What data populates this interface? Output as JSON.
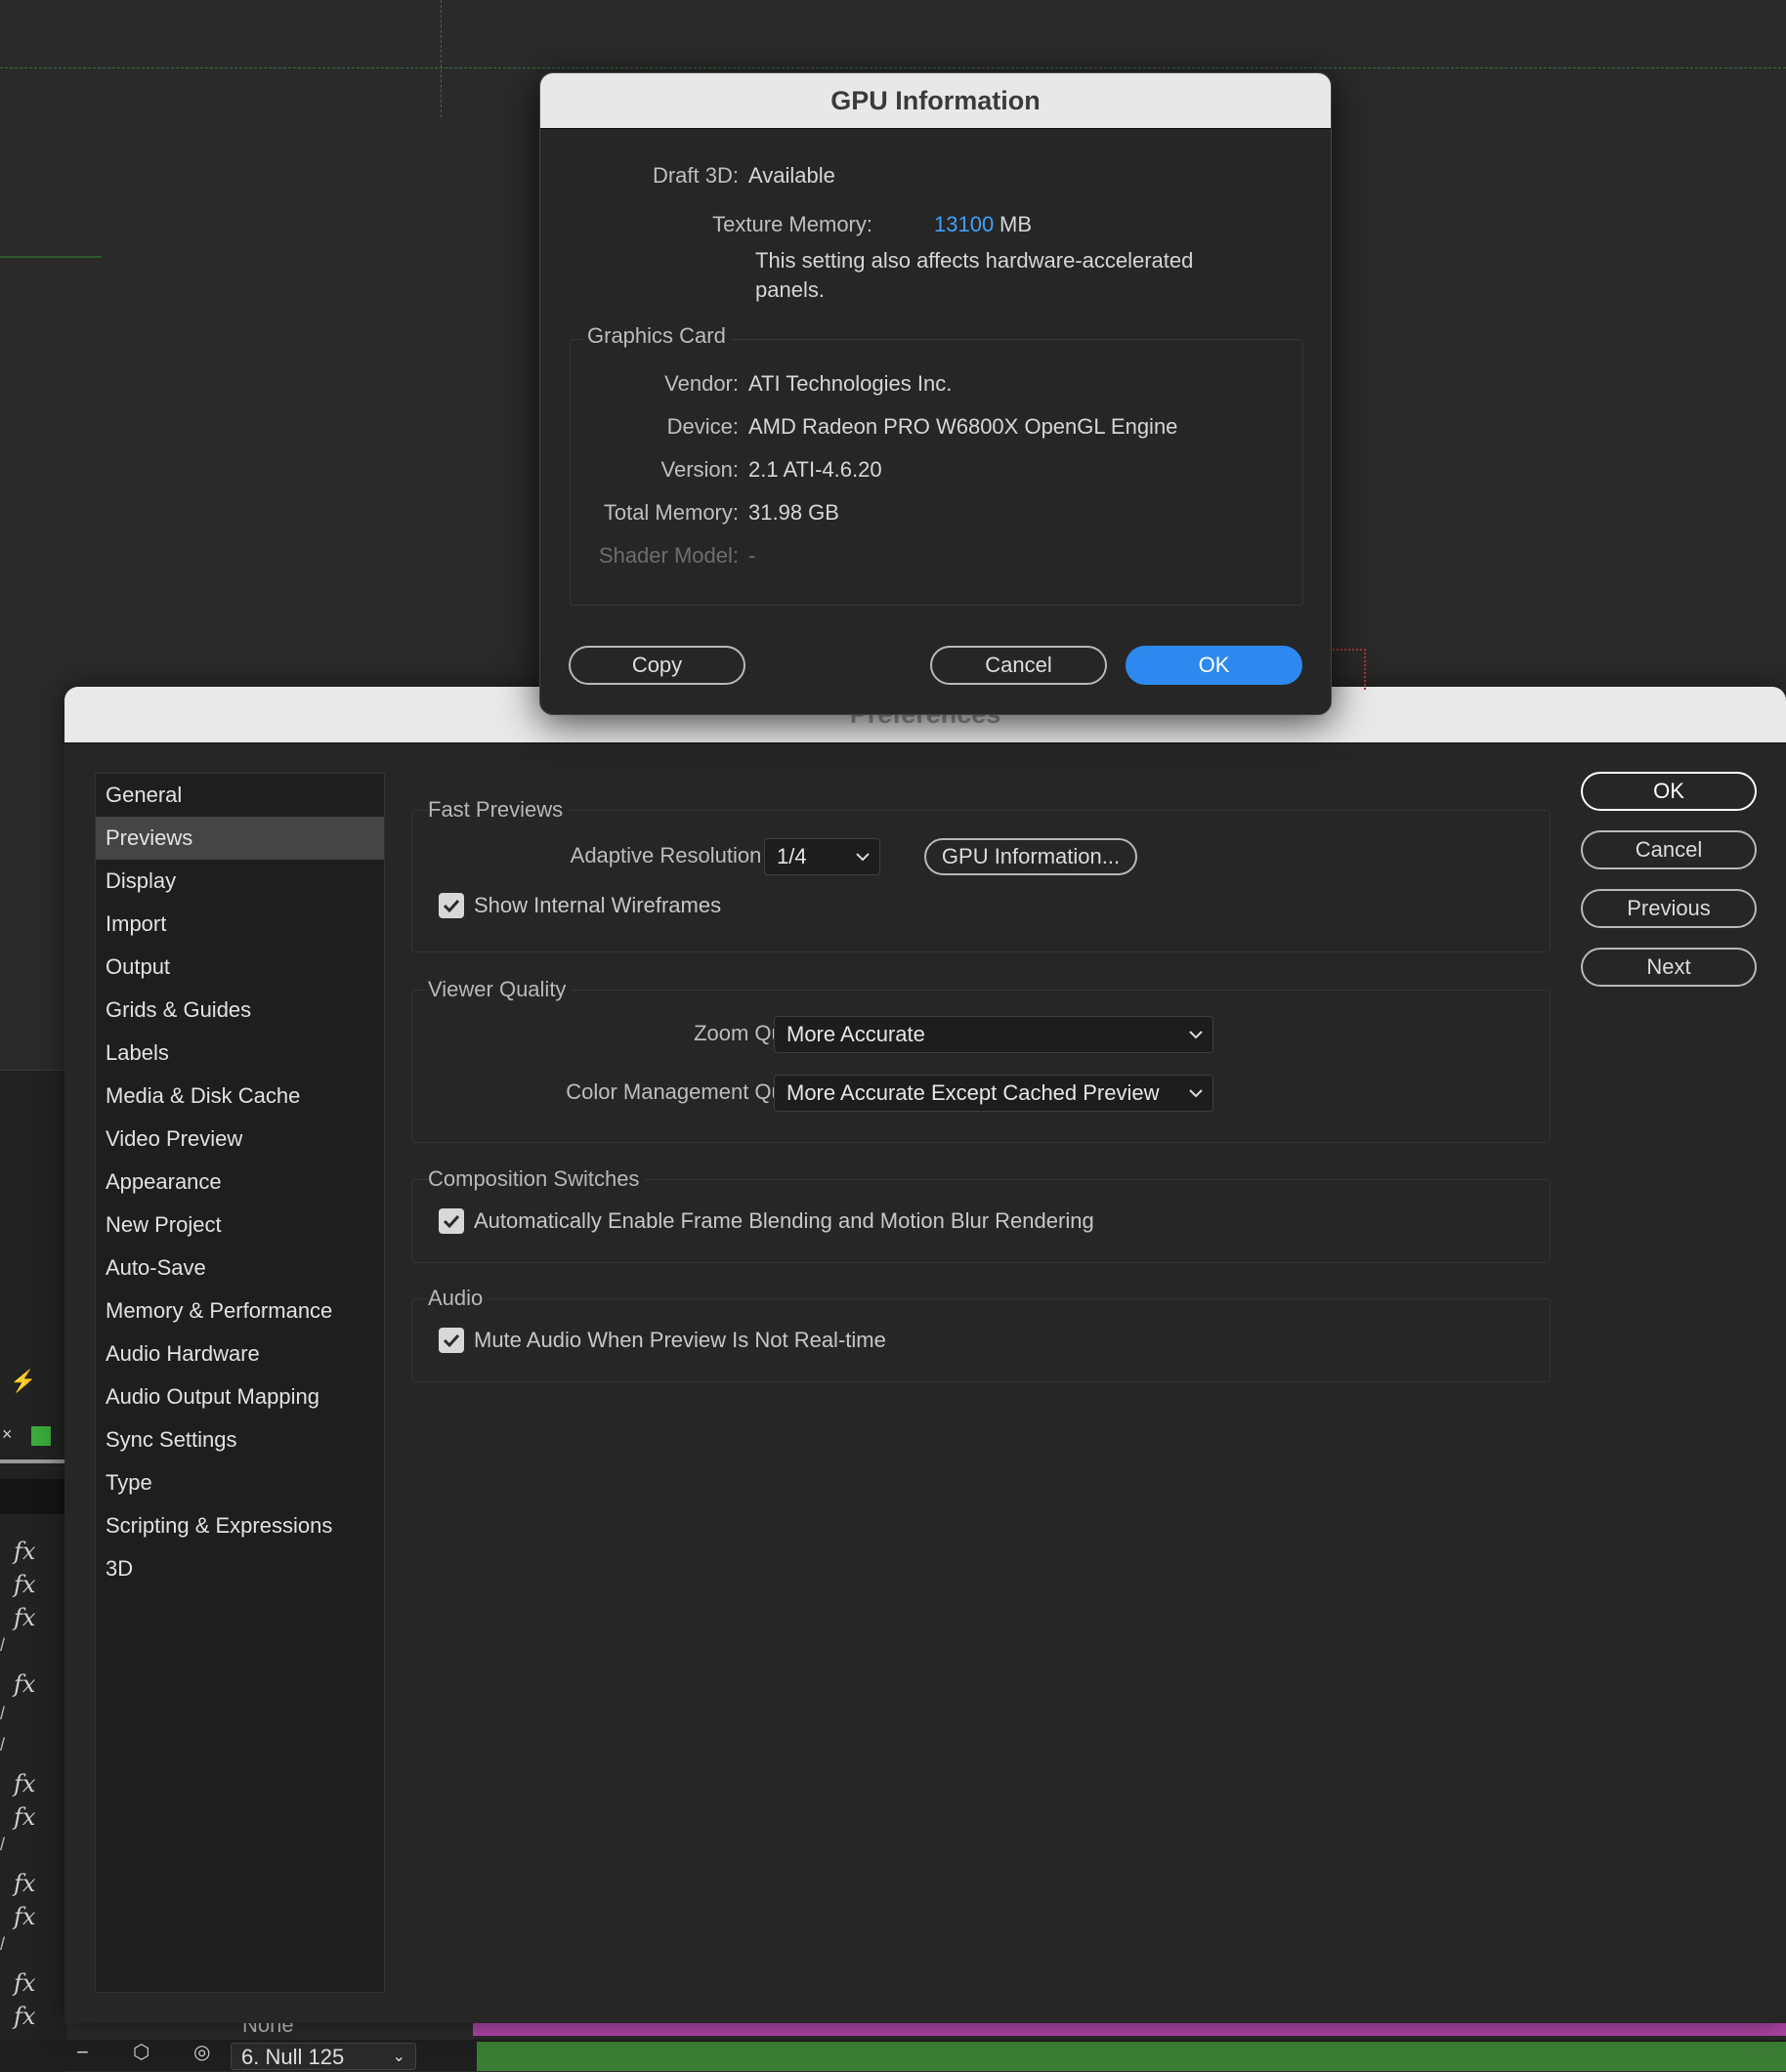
{
  "background": {
    "layer_name": "6. Null 125",
    "parent_value": "None",
    "fx_glyph": "fx"
  },
  "preferences": {
    "title": "Preferences",
    "categories": [
      "General",
      "Previews",
      "Display",
      "Import",
      "Output",
      "Grids & Guides",
      "Labels",
      "Media & Disk Cache",
      "Video Preview",
      "Appearance",
      "New Project",
      "Auto-Save",
      "Memory & Performance",
      "Audio Hardware",
      "Audio Output Mapping",
      "Sync Settings",
      "Type",
      "Scripting & Expressions",
      "3D"
    ],
    "selected_category": "Previews",
    "fast_previews": {
      "title": "Fast Previews",
      "adaptive_label": "Adaptive Resolution Limit:",
      "adaptive_value": "1/4",
      "gpu_info_button": "GPU Information...",
      "wireframes_label": "Show Internal Wireframes",
      "wireframes_checked": true
    },
    "viewer_quality": {
      "title": "Viewer Quality",
      "zoom_label": "Zoom Quality:",
      "zoom_value": "More Accurate",
      "color_label": "Color Management Quality:",
      "color_value": "More Accurate Except Cached Preview"
    },
    "composition_switches": {
      "title": "Composition Switches",
      "frame_blend_label": "Automatically Enable Frame Blending and Motion Blur Rendering",
      "frame_blend_checked": true
    },
    "audio": {
      "title": "Audio",
      "mute_label": "Mute Audio When Preview Is Not Real-time",
      "mute_checked": true
    },
    "buttons": {
      "ok": "OK",
      "cancel": "Cancel",
      "previous": "Previous",
      "next": "Next"
    }
  },
  "gpu_info": {
    "title": "GPU Information",
    "draft3d_label": "Draft 3D:",
    "draft3d_value": "Available",
    "texture_label": "Texture Memory:",
    "texture_value": "13100",
    "texture_unit": "MB",
    "texture_note": "This setting also affects hardware-accelerated panels.",
    "graphics_card_title": "Graphics Card",
    "vendor_label": "Vendor:",
    "vendor_value": "ATI Technologies Inc.",
    "device_label": "Device:",
    "device_value": "AMD Radeon PRO W6800X OpenGL Engine",
    "version_label": "Version:",
    "version_value": "2.1 ATI-4.6.20",
    "total_memory_label": "Total Memory:",
    "total_memory_value": "31.98 GB",
    "shader_label": "Shader Model:",
    "shader_value": "-",
    "buttons": {
      "copy": "Copy",
      "cancel": "Cancel",
      "ok": "OK"
    },
    "accent_color": "#2d89ef"
  }
}
